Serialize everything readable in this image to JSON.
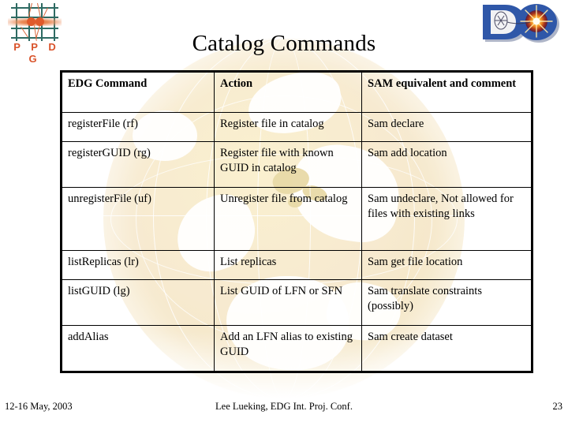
{
  "slide": {
    "title": "Catalog Commands",
    "background_watermark": "globe-watermark",
    "page_bg_color": "#ffffff",
    "watermark_color": "#f6e8c8"
  },
  "logos": {
    "left": {
      "name": "ppdg-logo",
      "text": "P P D G",
      "grid_color": "#2e6b63",
      "accent_color": "#d9532b"
    },
    "right": {
      "name": "d0-logo",
      "letters": "D0",
      "brand_color": "#2f57a8",
      "burst_color": "#f5a623"
    }
  },
  "table": {
    "name": "catalog-commands-table",
    "headers": [
      "EDG Command",
      "Action",
      "SAM equivalent and comment"
    ],
    "rows": [
      {
        "command": "registerFile (rf)",
        "action": "Register file in catalog",
        "sam": "Sam declare"
      },
      {
        "command": "registerGUID (rg)",
        "action": "Register file with known GUID in catalog",
        "sam": "Sam add location"
      },
      {
        "command": "unregisterFile (uf)",
        "action": "Unregister file from catalog",
        "sam": "Sam undeclare, Not allowed for files with existing links"
      },
      {
        "command": "listReplicas (lr)",
        "action": "List replicas",
        "sam": "Sam get file location"
      },
      {
        "command": "listGUID (lg)",
        "action": "List GUID of LFN or SFN",
        "sam": "Sam translate constraints (possibly)"
      },
      {
        "command": "addAlias",
        "action": "Add an LFN alias to existing GUID",
        "sam": "Sam create dataset"
      }
    ]
  },
  "footer": {
    "date": "12-16 May, 2003",
    "center": "Lee Lueking, EDG Int. Proj. Conf.",
    "page_number": "23"
  }
}
